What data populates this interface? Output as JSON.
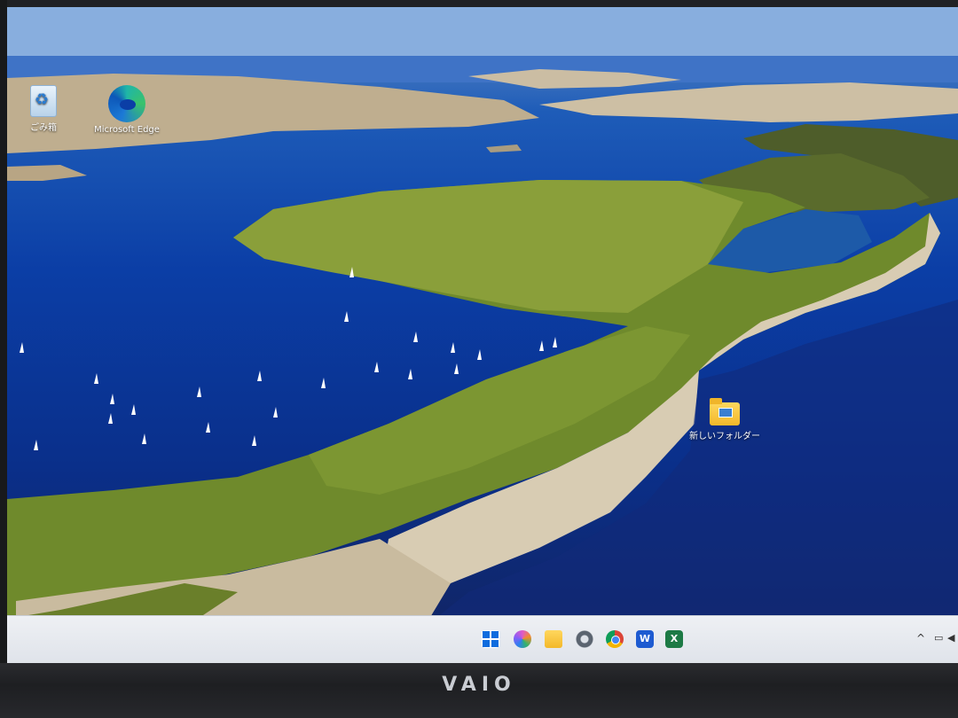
{
  "device": {
    "brand": "VAIO"
  },
  "desktop": {
    "icons": [
      {
        "label": "ごみ箱",
        "icon": "recycle-bin-icon"
      },
      {
        "label": "Microsoft Edge",
        "icon": "edge-icon"
      },
      {
        "label": "新しいフォルダー",
        "icon": "folder-icon"
      }
    ]
  },
  "taskbar": {
    "apps": [
      "start",
      "copilot",
      "file-explorer",
      "settings",
      "chrome",
      "word",
      "excel"
    ],
    "tray": {
      "chevron": "^"
    }
  },
  "colors": {
    "taskbar": "#e6e9ef",
    "sea": "#0b3ea6"
  }
}
